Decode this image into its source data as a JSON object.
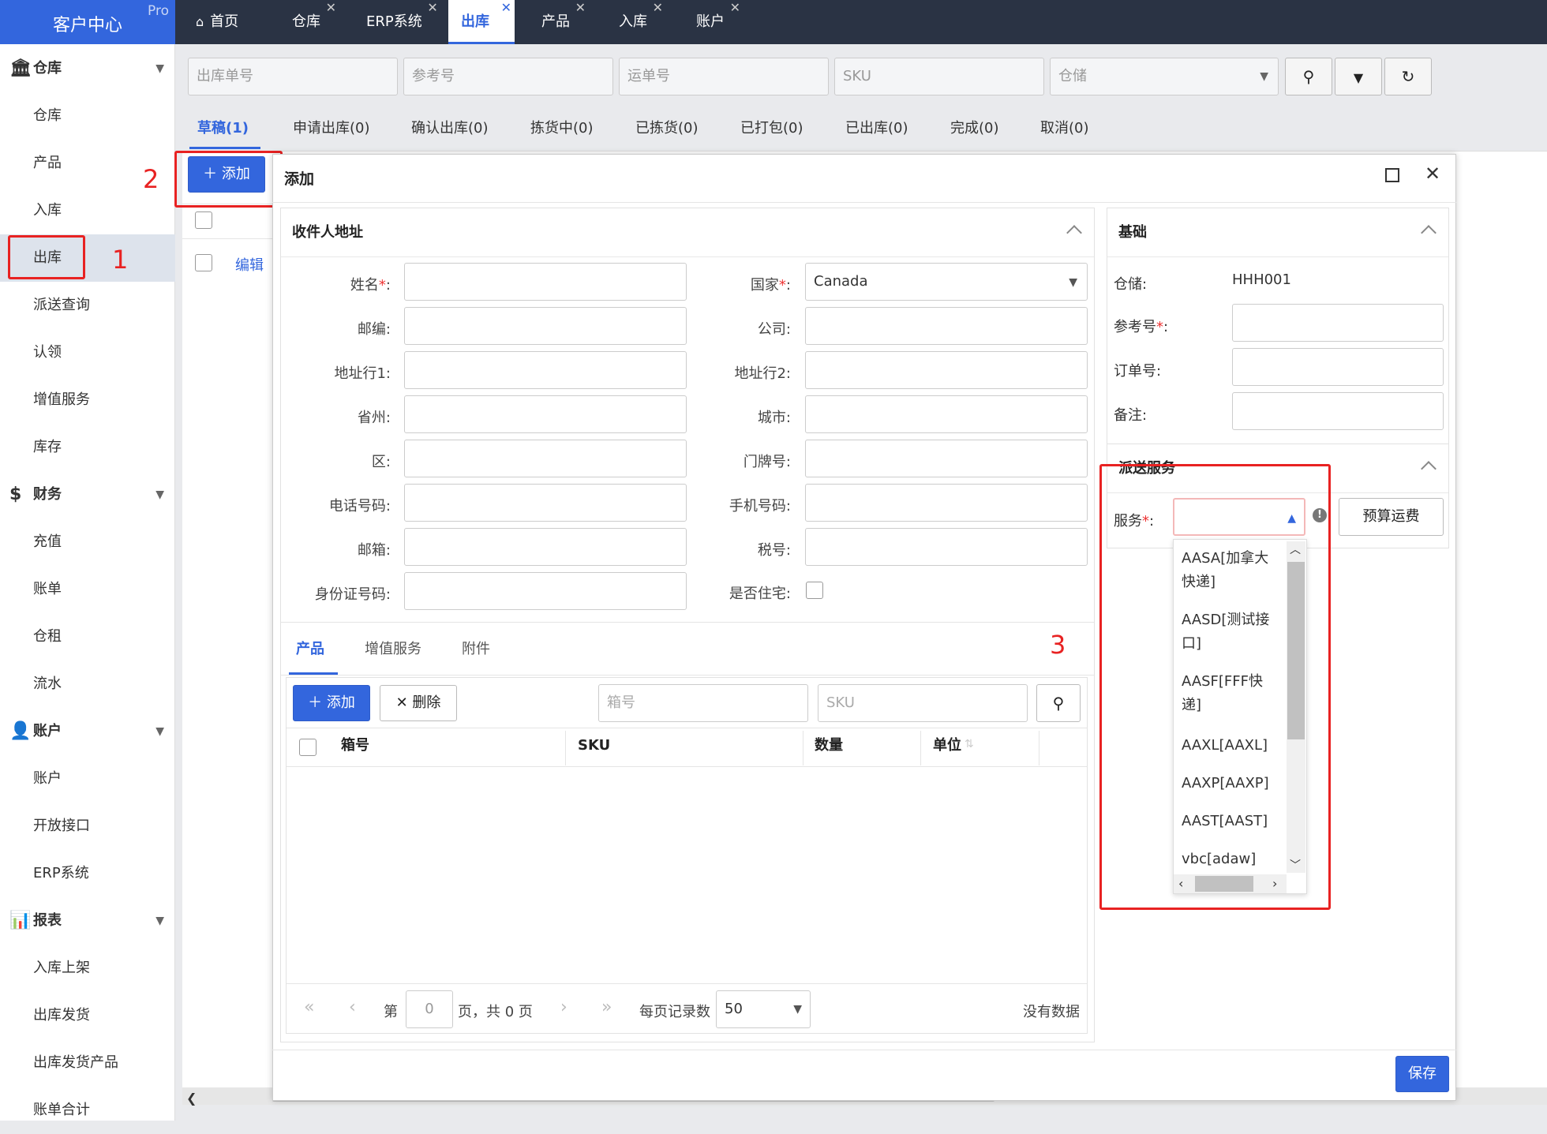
{
  "sidebar": {
    "logo": "客户中心",
    "logo_badge": "Pro",
    "items": [
      {
        "label": "仓库",
        "type": "group",
        "icon": "bank-icon"
      },
      {
        "label": "仓库",
        "type": "sub"
      },
      {
        "label": "产品",
        "type": "sub"
      },
      {
        "label": "入库",
        "type": "sub"
      },
      {
        "label": "出库",
        "type": "sub",
        "active": true
      },
      {
        "label": "派送查询",
        "type": "sub"
      },
      {
        "label": "认领",
        "type": "sub"
      },
      {
        "label": "增值服务",
        "type": "sub"
      },
      {
        "label": "库存",
        "type": "sub"
      },
      {
        "label": "财务",
        "type": "group",
        "icon": "dollar-icon"
      },
      {
        "label": "充值",
        "type": "sub"
      },
      {
        "label": "账单",
        "type": "sub"
      },
      {
        "label": "仓租",
        "type": "sub"
      },
      {
        "label": "流水",
        "type": "sub"
      },
      {
        "label": "账户",
        "type": "group",
        "icon": "user-icon"
      },
      {
        "label": "账户",
        "type": "sub"
      },
      {
        "label": "开放接口",
        "type": "sub"
      },
      {
        "label": "ERP系统",
        "type": "sub"
      },
      {
        "label": "报表",
        "type": "group",
        "icon": "bar-chart-icon"
      },
      {
        "label": "入库上架",
        "type": "sub"
      },
      {
        "label": "出库发货",
        "type": "sub"
      },
      {
        "label": "出库发货产品",
        "type": "sub"
      },
      {
        "label": "账单合计",
        "type": "sub"
      }
    ]
  },
  "topbar": {
    "tabs": [
      {
        "label": "首页",
        "closable": false,
        "icon": "home-icon"
      },
      {
        "label": "仓库",
        "closable": true
      },
      {
        "label": "ERP系统",
        "closable": true
      },
      {
        "label": "出库",
        "closable": true,
        "active": true
      },
      {
        "label": "产品",
        "closable": true
      },
      {
        "label": "入库",
        "closable": true
      },
      {
        "label": "账户",
        "closable": true
      }
    ]
  },
  "filters": {
    "outbound_no": "出库单号",
    "reference_no": "参考号",
    "waybill_no": "运单号",
    "sku": "SKU",
    "warehouse": "仓储"
  },
  "status_tabs": [
    "草稿(1)",
    "申请出库(0)",
    "确认出库(0)",
    "拣货中(0)",
    "已拣货(0)",
    "已打包(0)",
    "已出库(0)",
    "完成(0)",
    "取消(0)"
  ],
  "list": {
    "add_label": "添加",
    "edit_label": "编辑"
  },
  "dialog": {
    "title": "添加",
    "recipient": {
      "title": "收件人地址",
      "left_fields": [
        {
          "label": "姓名",
          "required": true,
          "value": ""
        },
        {
          "label": "邮编",
          "required": false,
          "value": ""
        },
        {
          "label": "地址行1",
          "required": false,
          "value": ""
        },
        {
          "label": "省州",
          "required": false,
          "value": ""
        },
        {
          "label": "区",
          "required": false,
          "value": ""
        },
        {
          "label": "电话号码",
          "required": false,
          "value": ""
        },
        {
          "label": "邮箱",
          "required": false,
          "value": ""
        },
        {
          "label": "身份证号码",
          "required": false,
          "value": ""
        }
      ],
      "right_fields": [
        {
          "label": "国家",
          "required": true,
          "value": "Canada"
        },
        {
          "label": "公司",
          "required": false,
          "value": ""
        },
        {
          "label": "地址行2",
          "required": false,
          "value": ""
        },
        {
          "label": "城市",
          "required": false,
          "value": ""
        },
        {
          "label": "门牌号",
          "required": false,
          "value": ""
        },
        {
          "label": "手机号码",
          "required": false,
          "value": ""
        },
        {
          "label": "税号",
          "required": false,
          "value": ""
        }
      ],
      "residential_label": "是否住宅"
    },
    "product_tabs": [
      "产品",
      "增值服务",
      "附件"
    ],
    "product_toolbar": {
      "add": "添加",
      "delete": "删除",
      "box_placeholder": "箱号",
      "sku_placeholder": "SKU"
    },
    "table_headers": [
      "箱号",
      "SKU",
      "数量",
      "单位"
    ],
    "pagination": {
      "page_prefix": "第",
      "page_value": "0",
      "page_suffix": "页，共 0 页",
      "per_page_label": "每页记录数",
      "per_page_value": "50",
      "empty": "没有数据"
    },
    "basic": {
      "title": "基础",
      "warehouse_label": "仓储",
      "warehouse_value": "HHH001",
      "reference_label": "参考号",
      "order_label": "订单号",
      "remark_label": "备注"
    },
    "delivery": {
      "title": "派送服务",
      "service_label": "服务",
      "estimate_button": "预算运费",
      "options": [
        "AASA[加拿大快递]",
        "AASD[测试接口]",
        "AASF[FFF快递]",
        "AAXL[AAXL]",
        "AAXP[AAXP]",
        "AAST[AAST]",
        "vbc[adaw]"
      ]
    },
    "save": "保存"
  },
  "annotations": [
    "1",
    "2",
    "3"
  ],
  "colors": {
    "accent": "#3366dd",
    "dark": "#2a3344",
    "annotation": "#e82222"
  }
}
